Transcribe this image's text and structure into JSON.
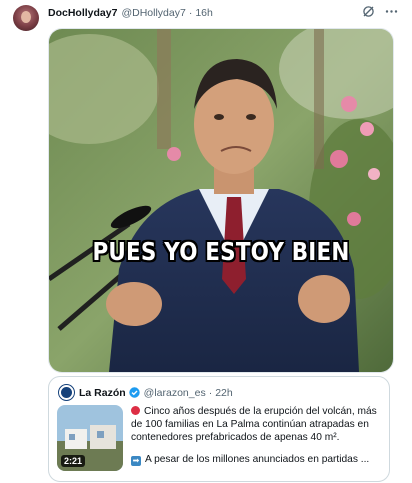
{
  "tweet": {
    "author_name": "DocHollyday7",
    "author_handle": "@DHollyday7",
    "dot": "·",
    "time": "16h",
    "icons": [
      "grok-icon",
      "more-icon"
    ],
    "media": {
      "caption": "PUES YO ESTOY BIEN"
    }
  },
  "quote": {
    "author_name": "La Razón",
    "verified_icon": "verified-badge-icon",
    "author_handle": "@larazon_es",
    "dot": "·",
    "time": "22h",
    "video_duration": "2:21",
    "text_line1": "Cinco años después de la erupción del volcán, más de 100 familias en La Palma continúan atrapadas en contenedores prefabricados de apenas 40 m².",
    "text_line2": "A pesar de los millones anunciados en partidas ...",
    "emoji1": "red-circle-icon",
    "emoji2": "right-arrow-icon",
    "colors": {
      "verified": "#1d9bf0",
      "red_circle": "#dd2e44",
      "arrow": "#3b88c3"
    }
  }
}
